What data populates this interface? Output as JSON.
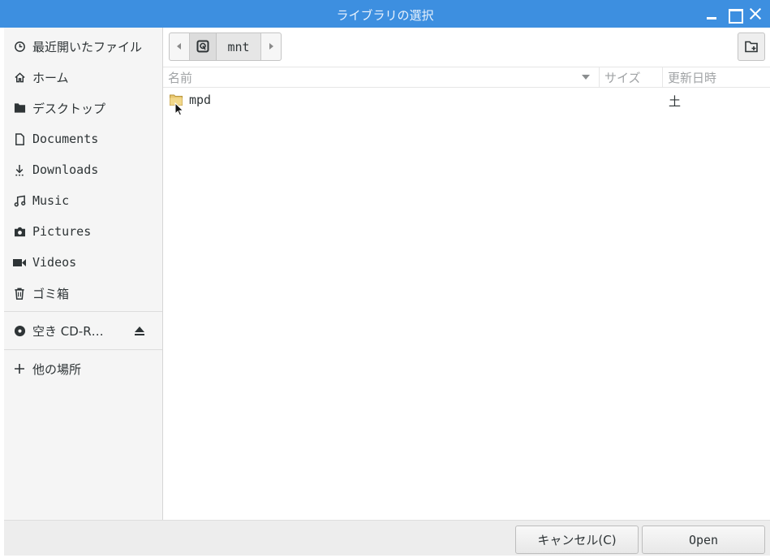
{
  "window": {
    "title": "ライブラリの選択"
  },
  "sidebar": {
    "places": [
      {
        "label": "最近開いたファイル",
        "icon": "recent-icon"
      },
      {
        "label": "ホーム",
        "icon": "home-icon"
      },
      {
        "label": "デスクトップ",
        "icon": "desktop-folder-icon"
      },
      {
        "label": "Documents",
        "icon": "document-icon"
      },
      {
        "label": "Downloads",
        "icon": "download-icon"
      },
      {
        "label": "Music",
        "icon": "music-icon"
      },
      {
        "label": "Pictures",
        "icon": "camera-icon"
      },
      {
        "label": "Videos",
        "icon": "video-icon"
      },
      {
        "label": "ゴミ箱",
        "icon": "trash-icon"
      }
    ],
    "devices": [
      {
        "label": "空き CD-R…",
        "icon": "cd-icon"
      }
    ],
    "other": {
      "label": "他の場所",
      "icon": "plus-icon"
    }
  },
  "pathbar": {
    "segments": [
      "mnt"
    ]
  },
  "file_list": {
    "columns": {
      "name": "名前",
      "size": "サイズ",
      "modified": "更新日時"
    },
    "rows": [
      {
        "name": "mpd",
        "size": "",
        "modified": "土",
        "icon": "folder-icon"
      }
    ]
  },
  "buttons": {
    "cancel": "キャンセル(C)",
    "open": "Open"
  }
}
